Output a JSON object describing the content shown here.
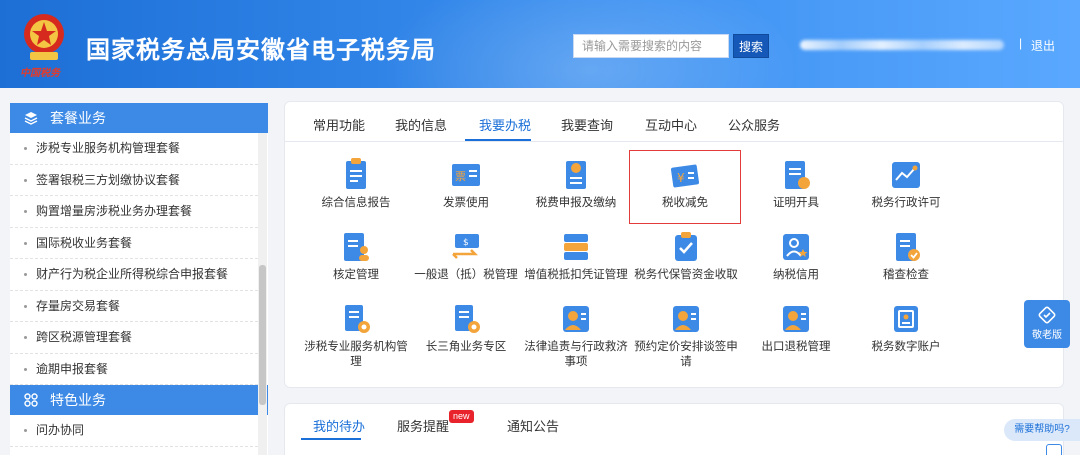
{
  "header": {
    "emblem_text": "中国税务",
    "title": "国家税务总局安徽省电子税务局",
    "search_placeholder": "请输入需要搜索的内容",
    "search_button": "搜索",
    "separator": "|",
    "logout": "退出"
  },
  "sidebar": {
    "section1": "套餐业务",
    "items": [
      "涉税专业服务机构管理套餐",
      "签署银税三方划缴协议套餐",
      "购置增量房涉税业务办理套餐",
      "国际税收业务套餐",
      "财产行为税企业所得税综合申报套餐",
      "存量房交易套餐",
      "跨区税源管理套餐",
      "逾期申报套餐"
    ],
    "section2": "特色业务",
    "items2": [
      "问办协同"
    ]
  },
  "main": {
    "tabs": [
      "常用功能",
      "我的信息",
      "我要办税",
      "我要查询",
      "互动中心",
      "公众服务"
    ],
    "active_tab": "我要办税",
    "tiles": [
      {
        "label": "综合信息报告",
        "icon": "report-icon"
      },
      {
        "label": "发票使用",
        "icon": "invoice-icon"
      },
      {
        "label": "税费申报及缴纳",
        "icon": "tax-filing-icon"
      },
      {
        "label": "税收减免",
        "icon": "tax-reduction-icon",
        "highlighted": true
      },
      {
        "label": "证明开具",
        "icon": "certificate-icon"
      },
      {
        "label": "税务行政许可",
        "icon": "license-icon"
      },
      {
        "label": "核定管理",
        "icon": "assessment-icon"
      },
      {
        "label": "一般退（抵）税管理",
        "icon": "refund-icon"
      },
      {
        "label": "增值税抵扣凭证管理",
        "icon": "vat-voucher-icon"
      },
      {
        "label": "税务代保管资金收取",
        "icon": "custody-fund-icon"
      },
      {
        "label": "纳税信用",
        "icon": "credit-icon"
      },
      {
        "label": "稽查检查",
        "icon": "inspection-icon"
      },
      {
        "label": "涉税专业服务机构管理",
        "icon": "agency-icon"
      },
      {
        "label": "长三角业务专区",
        "icon": "yangtze-delta-icon"
      },
      {
        "label": "法律追责与行政救济事项",
        "icon": "legal-icon"
      },
      {
        "label": "预约定价安排谈签申请",
        "icon": "pricing-icon"
      },
      {
        "label": "出口退税管理",
        "icon": "export-refund-icon"
      },
      {
        "label": "税务数字账户",
        "icon": "digital-account-icon"
      }
    ]
  },
  "bottom": {
    "tabs": [
      "我的待办",
      "服务提醒",
      "通知公告"
    ],
    "new_badge": "new"
  },
  "floating": {
    "elder_mode": "敬老版",
    "help": "需要帮助吗?"
  },
  "colors": {
    "header_blue": "#1d6fd6",
    "accent": "#1a6fd8",
    "sidebar_head": "#3d8ae6",
    "highlight_border": "#e33b3b"
  }
}
